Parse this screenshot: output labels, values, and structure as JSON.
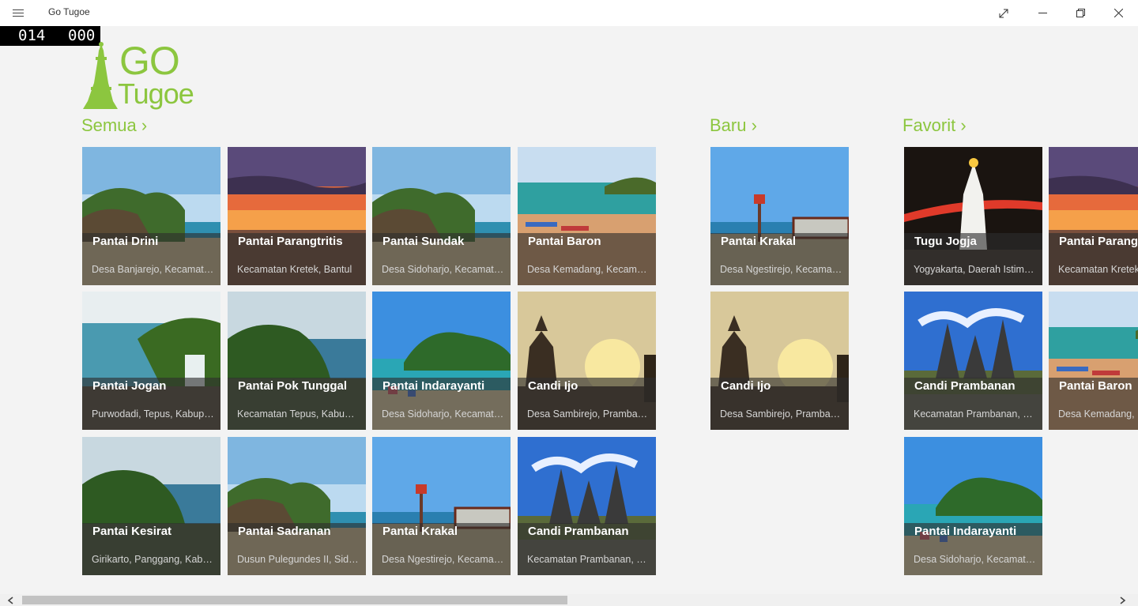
{
  "window": {
    "title": "Go Tugoe",
    "menu_icon": "hamburger-icon",
    "controls": [
      "fullscreen-icon",
      "minimize-icon",
      "restore-icon",
      "close-icon"
    ]
  },
  "counter": {
    "left": "014",
    "right": "000"
  },
  "logo": {
    "top": "GO",
    "bottom": "Tugoe",
    "color": "#8cc63f"
  },
  "sections": {
    "semua": {
      "header": "Semua ›",
      "tiles": [
        {
          "name": "Pantai Drini",
          "location": "Desa Banjarejo, Kecamatan Tanjungsari"
        },
        {
          "name": "Pantai Parangtritis",
          "location": "Kecamatan Kretek, Bantul"
        },
        {
          "name": "Pantai Sundak",
          "location": "Desa Sidoharjo, Kecamatan Tepus"
        },
        {
          "name": "Pantai Baron",
          "location": "Desa Kemadang, Kecamatan Tanjungsari"
        },
        {
          "name": "Pantai Jogan",
          "location": "Purwodadi, Tepus, Kabupaten Gunungkidul"
        },
        {
          "name": "Pantai Pok Tunggal",
          "location": "Kecamatan Tepus, Kabupaten Gunungkidul"
        },
        {
          "name": "Pantai Indarayanti",
          "location": "Desa Sidoharjo, Kecamatan Tepus"
        },
        {
          "name": "Candi Ijo",
          "location": "Desa Sambirejo, Prambanan"
        },
        {
          "name": "Pantai Kesirat",
          "location": "Girikarto, Panggang, Kabupaten Gunungkidul"
        },
        {
          "name": "Pantai Sadranan",
          "location": "Dusun Pulegundes II, Sidoharjo"
        },
        {
          "name": "Pantai Krakal",
          "location": "Desa Ngestirejo, Kecamatan Tanjungsari"
        },
        {
          "name": "Candi Prambanan",
          "location": "Kecamatan Prambanan, Sleman"
        }
      ]
    },
    "baru": {
      "header": "Baru ›",
      "tiles": [
        {
          "name": "Pantai Krakal",
          "location": "Desa Ngestirejo, Kecamatan Tanjungsari"
        },
        {
          "name": "Candi Ijo",
          "location": "Desa Sambirejo, Prambanan"
        }
      ]
    },
    "favorit": {
      "header": "Favorit ›",
      "tiles": [
        {
          "name": "Tugu Jogja",
          "location": "Yogyakarta, Daerah Istimewa Yogyakarta"
        },
        {
          "name": "Pantai Parangtritis",
          "location": "Kecamatan Kretek, Bantul"
        },
        {
          "name": "Candi Prambanan",
          "location": "Kecamatan Prambanan, Sleman"
        },
        {
          "name": "Pantai Baron",
          "location": "Desa Kemadang, Kecamatan Tanjungsari"
        },
        {
          "name": "Pantai Indarayanti",
          "location": "Desa Sidoharjo, Kecamatan Tepus"
        }
      ]
    }
  },
  "scrollbar": {
    "left_icon": "scroll-left-icon",
    "right_icon": "scroll-right-icon"
  }
}
